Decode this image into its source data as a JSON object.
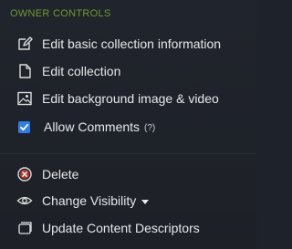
{
  "section": {
    "title": "OWNER CONTROLS"
  },
  "owner_items": [
    {
      "label": "Edit basic collection information",
      "icon": "pencil-edit-icon"
    },
    {
      "label": "Edit collection",
      "icon": "document-icon"
    },
    {
      "label": "Edit background image & video",
      "icon": "image-icon"
    }
  ],
  "allow_comments": {
    "label": "Allow Comments",
    "help": "(?)",
    "checked": true
  },
  "actions": [
    {
      "label": "Delete",
      "icon": "delete-circle-x-icon"
    },
    {
      "label": "Change Visibility",
      "icon": "eye-icon"
    },
    {
      "label": "Update Content Descriptors",
      "icon": "cards-icon"
    }
  ],
  "colors": {
    "background": "#1e222a",
    "section_title": "#6e9a32",
    "text": "#e6e8ea",
    "checkbox": "#2f7fe6",
    "delete_icon": "#c0392b"
  }
}
